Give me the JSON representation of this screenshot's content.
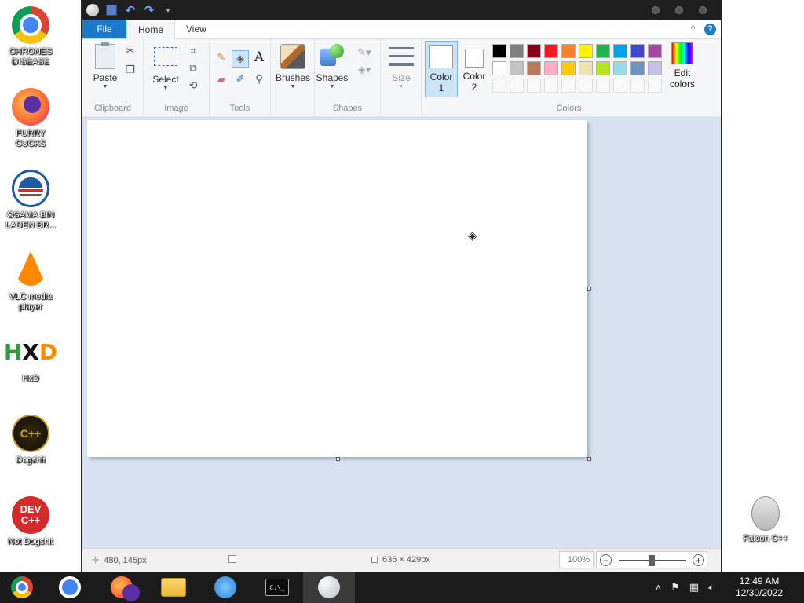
{
  "desktop": {
    "icons_left": [
      {
        "label": "CHRONES DISEASE"
      },
      {
        "label": "FURRY CUCKS"
      },
      {
        "label": "OSAMA BIN LADEN BR..."
      },
      {
        "label": "VLC media player"
      },
      {
        "label": "HxD"
      },
      {
        "label": "Dogshit"
      },
      {
        "label": "Not Dogshit"
      }
    ],
    "icons_right": [
      {
        "label": "Falcon C++"
      }
    ],
    "hxd_glyph": {
      "h": "H",
      "x": "X",
      "d": "D"
    },
    "dogshit_glyph": "C++",
    "devcpp_glyph": {
      "line1": "DEV",
      "line2": "C++"
    }
  },
  "paint": {
    "tabs": {
      "file": "File",
      "home": "Home",
      "view": "View"
    },
    "help_glyph": "?",
    "collapse_glyph": "^",
    "groups": {
      "clipboard": {
        "label": "Clipboard",
        "paste": "Paste"
      },
      "image": {
        "label": "Image",
        "select": "Select"
      },
      "tools": {
        "label": "Tools",
        "text_tool": "A"
      },
      "brushes": {
        "label": "Brushes"
      },
      "shapes": {
        "label": "Shapes",
        "shapes": "Shapes"
      },
      "size": {
        "label": "Size"
      },
      "colors": {
        "label": "Colors",
        "color1": "Color 1",
        "color1_line1": "Color",
        "color1_line2": "1",
        "color2_line1": "Color",
        "color2_line2": "2",
        "edit_line1": "Edit",
        "edit_line2": "colors",
        "palette_row1": [
          "#000000",
          "#7f7f7f",
          "#880015",
          "#ed1c24",
          "#ff7f27",
          "#fff200",
          "#22b14c",
          "#00a2e8",
          "#3f48cc",
          "#a349a4"
        ],
        "palette_row2": [
          "#ffffff",
          "#c3c3c3",
          "#b97a57",
          "#ffaec9",
          "#ffc90e",
          "#efe4b0",
          "#b5e61d",
          "#99d9ea",
          "#7092be",
          "#c8bfe7"
        ]
      }
    },
    "status": {
      "cursor_pos": "480, 145px",
      "canvas_size": "636 × 429px",
      "zoom": "100%"
    }
  },
  "taskbar": {
    "clock_time": "12:49 AM",
    "clock_date": "12/30/2022",
    "cmd_text": "C:\\_"
  }
}
